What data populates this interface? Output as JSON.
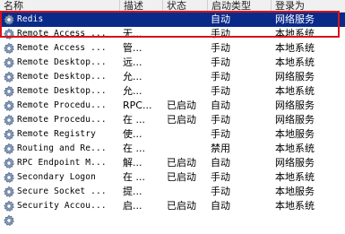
{
  "columns": {
    "name": "名称",
    "desc": "描述",
    "status": "状态",
    "start": "启动类型",
    "logon": "登录为"
  },
  "services": [
    {
      "name": "Redis",
      "desc": "",
      "status": "",
      "start": "自动",
      "logon": "网络服务",
      "selected": true
    },
    {
      "name": "Remote Access ...",
      "desc": "无...",
      "status": "",
      "start": "手动",
      "logon": "本地系统"
    },
    {
      "name": "Remote Access ...",
      "desc": "管...",
      "status": "",
      "start": "手动",
      "logon": "本地系统"
    },
    {
      "name": "Remote Desktop...",
      "desc": "远...",
      "status": "",
      "start": "手动",
      "logon": "本地系统"
    },
    {
      "name": "Remote Desktop...",
      "desc": "允...",
      "status": "",
      "start": "手动",
      "logon": "网络服务"
    },
    {
      "name": "Remote Desktop...",
      "desc": "允...",
      "status": "",
      "start": "手动",
      "logon": "本地系统"
    },
    {
      "name": "Remote Procedu...",
      "desc": "RPC...",
      "status": "已启动",
      "start": "自动",
      "logon": "网络服务"
    },
    {
      "name": "Remote Procedu...",
      "desc": "在 ...",
      "status": "已启动",
      "start": "手动",
      "logon": "网络服务"
    },
    {
      "name": "Remote Registry",
      "desc": "使...",
      "status": "",
      "start": "手动",
      "logon": "本地服务"
    },
    {
      "name": "Routing and Re...",
      "desc": "在 ...",
      "status": "",
      "start": "禁用",
      "logon": "本地系统"
    },
    {
      "name": "RPC Endpoint M...",
      "desc": "解...",
      "status": "已启动",
      "start": "自动",
      "logon": "网络服务"
    },
    {
      "name": "Secondary Logon",
      "desc": "在 ...",
      "status": "已启动",
      "start": "手动",
      "logon": "本地系统"
    },
    {
      "name": "Secure Socket ...",
      "desc": "提...",
      "status": "",
      "start": "手动",
      "logon": "本地服务"
    },
    {
      "name": "Security Accou...",
      "desc": "启...",
      "status": "已启动",
      "start": "自动",
      "logon": "本地系统"
    },
    {
      "name": "",
      "desc": "",
      "status": "",
      "start": "",
      "logon": ""
    }
  ],
  "colors": {
    "selection": "#0a2a8a",
    "highlight_box": "#d8131b"
  },
  "row_icon": "gear-icon"
}
